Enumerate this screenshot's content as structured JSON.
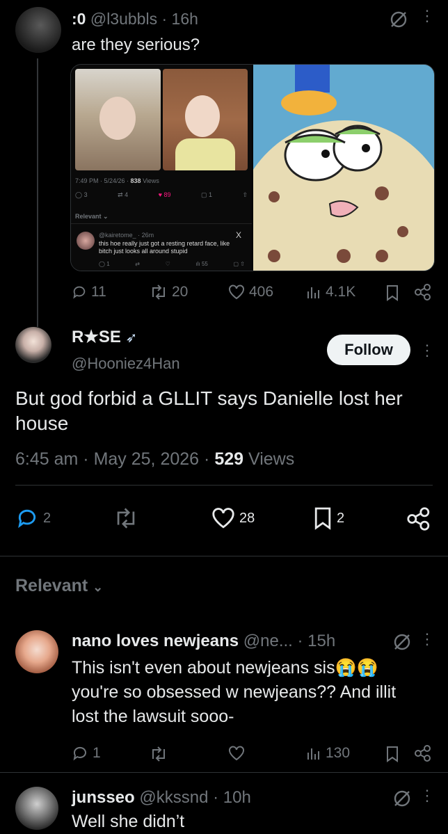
{
  "tweet1": {
    "display_name": ":0",
    "handle": "@l3ubbls",
    "sep": "·",
    "time": "16h",
    "text": "are they serious?",
    "actions": {
      "replies": "11",
      "retweets": "20",
      "likes": "406",
      "views": "4.1K"
    },
    "embedded": {
      "meta": "7:49 PM · 5/24/26 · ",
      "views_num": "838",
      "views_label": " Views",
      "replies": "3",
      "retweets": "4",
      "likes": "89",
      "bookmarks": "1",
      "relevant": "Relevant",
      "reply_handle": "@kairetome_ · 26m",
      "reply_text": "this hoe really just got a resting retard face, like bitch just looks all around stupid",
      "reply_replies": "1",
      "reply_views": "55"
    }
  },
  "main": {
    "display_name": "R★SE",
    "handle": "@Hooniez4Han",
    "follow": "Follow",
    "text": "But god forbid a GLLIT says Danielle lost her house",
    "time": "6:45 am",
    "date": "May 25, 2026",
    "views_num": "529",
    "views_label": "Views",
    "replies": "2",
    "likes": "28",
    "bookmarks": "2"
  },
  "relevant": {
    "label": "Relevant"
  },
  "reply1": {
    "display_name": "nano loves newjeans",
    "handle": "@ne...",
    "time": "15h",
    "text": "This isn't even about newjeans sis😭😭 you're so obsessed w newjeans?? And illit lost the lawsuit sooo-",
    "replies": "1",
    "views": "130"
  },
  "reply2": {
    "display_name": "junsseo",
    "handle": "@kkssnd",
    "time": "10h",
    "text": "Well she didn’t"
  },
  "colors": {
    "bg": "#000000",
    "text": "#e7e9ea",
    "muted": "#71767b",
    "like": "#f91880",
    "divider": "#2f3336"
  }
}
